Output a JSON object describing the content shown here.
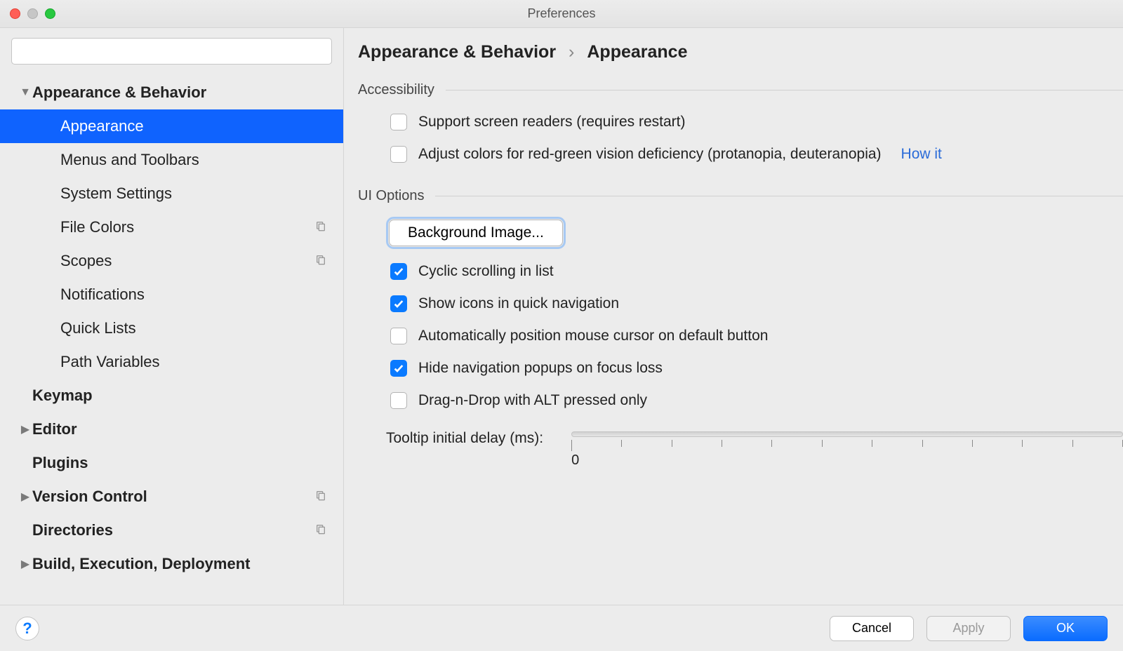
{
  "window": {
    "title": "Preferences"
  },
  "search": {
    "placeholder": ""
  },
  "sidebar": {
    "items": [
      {
        "label": "Appearance & Behavior",
        "bold": true,
        "disclosure": "down",
        "indent": 0
      },
      {
        "label": "Appearance",
        "indent": 1,
        "selected": true
      },
      {
        "label": "Menus and Toolbars",
        "indent": 1
      },
      {
        "label": "System Settings",
        "indent": 1,
        "disclosure": "right"
      },
      {
        "label": "File Colors",
        "indent": 1,
        "flag": true
      },
      {
        "label": "Scopes",
        "indent": 1,
        "flag": true
      },
      {
        "label": "Notifications",
        "indent": 1
      },
      {
        "label": "Quick Lists",
        "indent": 1
      },
      {
        "label": "Path Variables",
        "indent": 1
      },
      {
        "label": "Keymap",
        "bold": true,
        "indent": 0
      },
      {
        "label": "Editor",
        "bold": true,
        "disclosure": "right",
        "indent": 0
      },
      {
        "label": "Plugins",
        "bold": true,
        "indent": 0
      },
      {
        "label": "Version Control",
        "bold": true,
        "disclosure": "right",
        "indent": 0,
        "flag": true
      },
      {
        "label": "Directories",
        "bold": true,
        "indent": 0,
        "flag": true
      },
      {
        "label": "Build, Execution, Deployment",
        "bold": true,
        "disclosure": "right",
        "indent": 0
      }
    ]
  },
  "breadcrumb": {
    "parent": "Appearance & Behavior",
    "sep": "›",
    "current": "Appearance"
  },
  "sections": {
    "accessibility": {
      "title": "Accessibility",
      "opt_screen_readers": "Support screen readers (requires restart)",
      "opt_color_deficiency": "Adjust colors for red-green vision deficiency (protanopia, deuteranopia)",
      "how_it": "How it"
    },
    "ui_options": {
      "title": "UI Options",
      "bg_image_btn": "Background Image...",
      "opt_cyclic": "Cyclic scrolling in list",
      "opt_icons_quicknav": "Show icons in quick navigation",
      "opt_auto_mouse": "Automatically position mouse cursor on default button",
      "opt_hide_popups": "Hide navigation popups on focus loss",
      "opt_dnd_alt": "Drag-n-Drop with ALT pressed only",
      "tooltip_label": "Tooltip initial delay (ms):",
      "tooltip_value": "0"
    }
  },
  "footer": {
    "help": "?",
    "cancel": "Cancel",
    "apply": "Apply",
    "ok": "OK"
  }
}
